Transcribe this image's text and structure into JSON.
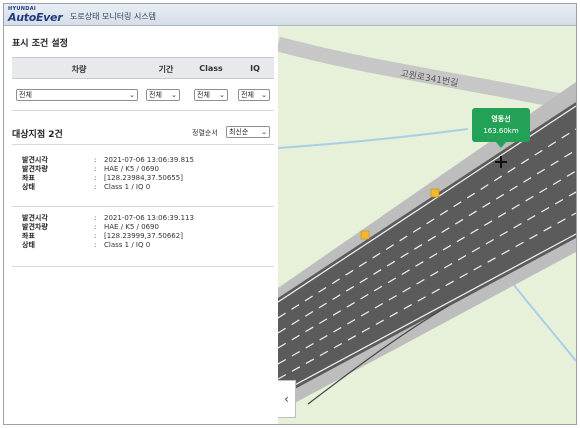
{
  "header": {
    "logo_small": "HYUNDAI",
    "logo_big": "AutoEver",
    "app_title": "도로상태 모니터링 시스템"
  },
  "filter": {
    "section_title": "표시 조건 설정",
    "columns": [
      "차량",
      "기간",
      "Class",
      "IQ"
    ],
    "values": [
      "전체",
      "전체",
      "전체",
      "전체"
    ]
  },
  "results": {
    "count_title": "대상지점 2건",
    "sort_label": "정렬순서",
    "sort_value": "최신순",
    "labels": [
      "발견시각",
      "발견차량",
      "좌표",
      "상태"
    ],
    "items": [
      {
        "time": "2021-07-06 13:06:39.815",
        "vehicle": "HAE / K5 / 0690",
        "coords": "[128.23984,37.50655]",
        "status": "Class 1 / IQ 0"
      },
      {
        "time": "2021-07-06 13:06:39.113",
        "vehicle": "HAE / K5 / 0690",
        "coords": "[128.23999,37.50662]",
        "status": "Class 1 / IQ 0"
      }
    ]
  },
  "map": {
    "road_label": "고원로341번길",
    "callout_name": "영동선",
    "callout_distance": "163.60km",
    "toggle_glyph": "‹",
    "colors": {
      "land": "#e7f0d9",
      "highway": "#5b5b5b",
      "shoulder": "#bdbdbd",
      "callout": "#23a157",
      "marker": "#f2b82e",
      "river": "#a8cfe8"
    }
  }
}
